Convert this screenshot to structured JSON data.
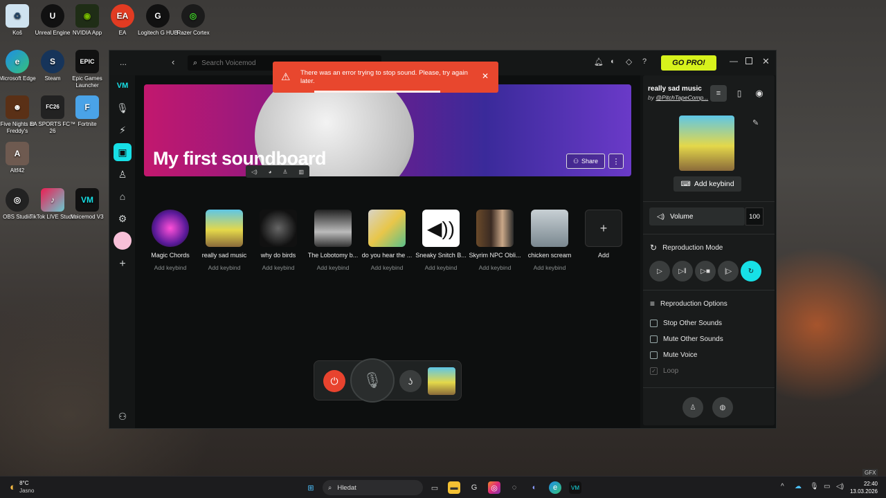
{
  "desktop": {
    "icons": [
      "Koš",
      "Unreal Engine",
      "NVIDIA App",
      "EA",
      "Logitech G HUB",
      "Razer Cortex",
      "Microsoft Edge",
      "Steam",
      "Epic Games Launcher",
      "Five Nights at Freddy's",
      "EA SPORTS FC™ 26",
      "Fortnite",
      "Altf42",
      "OBS Studio",
      "TikTok LIVE Studio",
      "Voicemod V3"
    ]
  },
  "app": {
    "menu": "...",
    "search_placeholder": "Search Voicemod",
    "error": "There was an error trying to stop sound. Please, try again later.",
    "go_pro": "GO PRO!",
    "help": "?"
  },
  "soundboard": {
    "title": "My first soundboard",
    "share": "Share",
    "sounds": [
      {
        "name": "Magic Chords",
        "keybind": "Add keybind"
      },
      {
        "name": "really sad music",
        "keybind": "Add keybind"
      },
      {
        "name": "why do birds",
        "keybind": "Add keybind"
      },
      {
        "name": "The Lobotomy b...",
        "keybind": "Add keybind"
      },
      {
        "name": "do you hear the ...",
        "keybind": "Add keybind"
      },
      {
        "name": "Sneaky Snitch B...",
        "keybind": "Add keybind"
      },
      {
        "name": "Skyrim NPC Obli...",
        "keybind": "Add keybind"
      },
      {
        "name": "chicken scream",
        "keybind": "Add keybind"
      }
    ],
    "add": "Add"
  },
  "detail": {
    "title": "really sad music",
    "by": "by",
    "author": "@PitchTapeComp...",
    "add_keybind": "Add keybind",
    "volume_label": "Volume",
    "volume_value": "100",
    "repro_mode": "Reproduction Mode",
    "repro_options": "Reproduction Options",
    "options": [
      "Stop Other Sounds",
      "Mute Other Sounds",
      "Mute Voice",
      "Loop"
    ]
  },
  "taskbar": {
    "weather_temp": "8°C",
    "weather_desc": "Jasno",
    "search": "Hledat",
    "time": "22:40",
    "date": "13.03.2026",
    "gfx": "GFX"
  },
  "colors": {
    "accent": "#17e0e6",
    "gopro": "#d7f21c",
    "error": "#e8472e",
    "power": "#e8432e"
  }
}
